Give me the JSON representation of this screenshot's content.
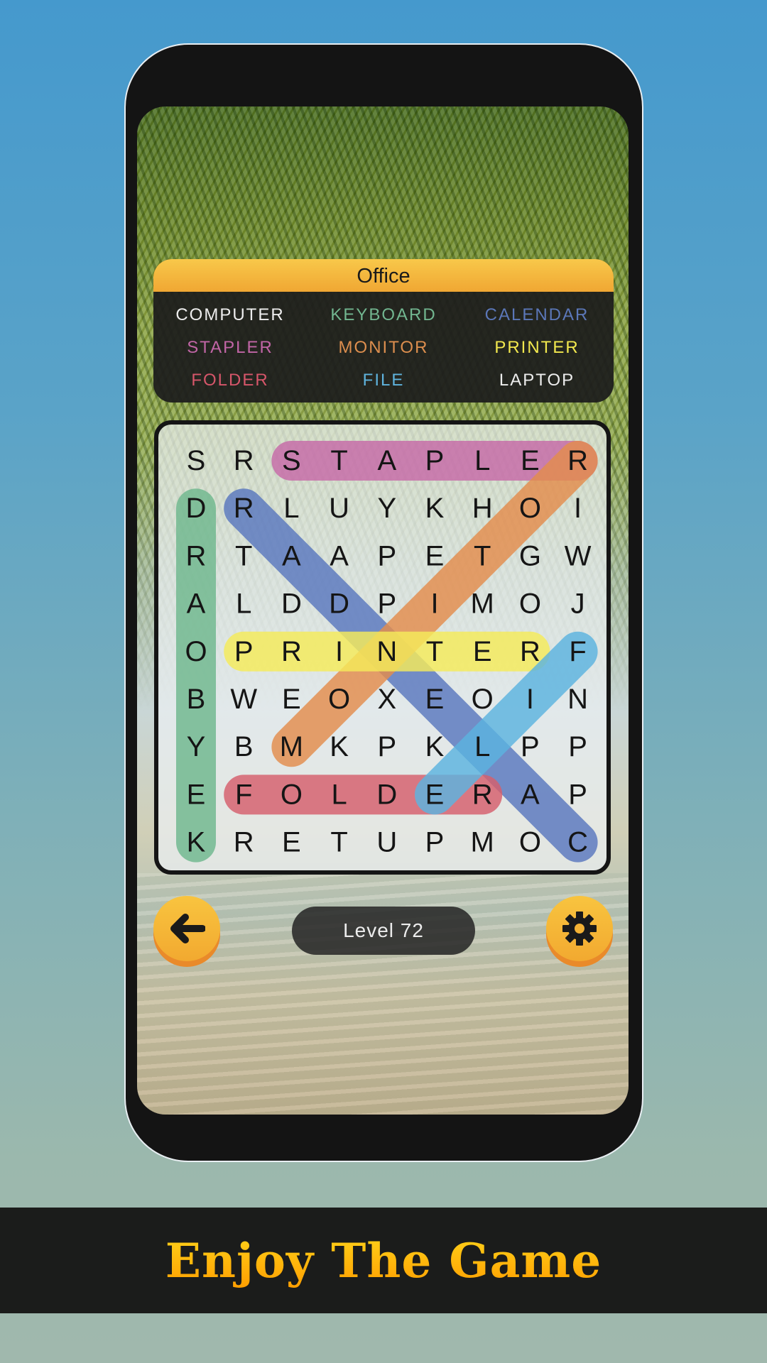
{
  "category": "Office",
  "words": [
    {
      "text": "COMPUTER",
      "color": "#ededed"
    },
    {
      "text": "KEYBOARD",
      "color": "#72b690"
    },
    {
      "text": "CALENDAR",
      "color": "#5b77b8"
    },
    {
      "text": "STAPLER",
      "color": "#c165a6"
    },
    {
      "text": "MONITOR",
      "color": "#dc8e4e"
    },
    {
      "text": "PRINTER",
      "color": "#f2e84e"
    },
    {
      "text": "FOLDER",
      "color": "#d6566a"
    },
    {
      "text": "FILE",
      "color": "#5fb3dd"
    },
    {
      "text": "LAPTOP",
      "color": "#ededed"
    }
  ],
  "grid": [
    [
      "S",
      "R",
      "S",
      "T",
      "A",
      "P",
      "L",
      "E",
      "R"
    ],
    [
      "D",
      "R",
      "L",
      "U",
      "Y",
      "K",
      "H",
      "O",
      "I"
    ],
    [
      "R",
      "T",
      "A",
      "A",
      "P",
      "E",
      "T",
      "G",
      "W"
    ],
    [
      "A",
      "L",
      "D",
      "D",
      "P",
      "I",
      "M",
      "O",
      "J"
    ],
    [
      "O",
      "P",
      "R",
      "I",
      "N",
      "T",
      "E",
      "R",
      "F"
    ],
    [
      "B",
      "W",
      "E",
      "O",
      "X",
      "E",
      "O",
      "I",
      "N"
    ],
    [
      "Y",
      "B",
      "M",
      "K",
      "P",
      "K",
      "L",
      "P",
      "P"
    ],
    [
      "E",
      "F",
      "O",
      "L",
      "D",
      "E",
      "R",
      "A",
      "P"
    ],
    [
      "K",
      "R",
      "E",
      "T",
      "U",
      "P",
      "M",
      "O",
      "C"
    ]
  ],
  "found": [
    {
      "word": "KEYBOARD",
      "from": [
        8,
        0
      ],
      "to": [
        1,
        0
      ],
      "color": "#6fb88e"
    },
    {
      "word": "STAPLER",
      "from": [
        0,
        2
      ],
      "to": [
        0,
        8
      ],
      "color": "#c76aa8"
    },
    {
      "word": "CALENDAR",
      "from": [
        8,
        8
      ],
      "to": [
        1,
        1
      ],
      "color": "#5a78bf"
    },
    {
      "word": "MONITOR",
      "from": [
        6,
        2
      ],
      "to": [
        0,
        8
      ],
      "color": "#e48d4d"
    },
    {
      "word": "PRINTER",
      "from": [
        4,
        1
      ],
      "to": [
        4,
        7
      ],
      "color": "#f6ec5a"
    },
    {
      "word": "FOLDER",
      "from": [
        7,
        1
      ],
      "to": [
        7,
        6
      ],
      "color": "#d65f6d"
    },
    {
      "word": "FILE",
      "from": [
        4,
        8
      ],
      "to": [
        7,
        5
      ],
      "color": "#5cb4e0"
    }
  ],
  "level_label": "Level 72",
  "back_icon": "arrow-left-icon",
  "settings_icon": "gear-icon",
  "banner_text": "Enjoy The Game"
}
